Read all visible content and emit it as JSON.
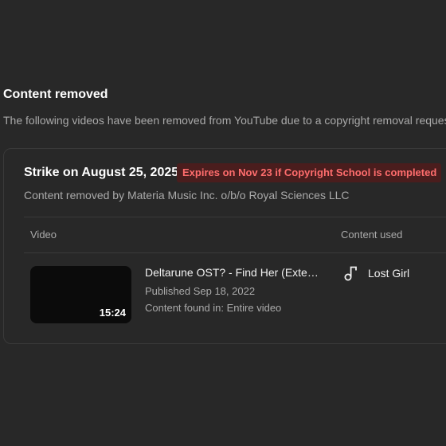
{
  "section": {
    "title": "Content removed",
    "description": "The following videos have been removed from YouTube due to a copyright removal request"
  },
  "strike": {
    "title": "Strike on August 25, 2025",
    "badge": "Expires on Nov 23 if Copyright School is completed",
    "claimant": "Content removed by Materia Music Inc. o/b/o Royal Sciences LLC"
  },
  "table": {
    "headers": {
      "video": "Video",
      "content_used": "Content used"
    },
    "rows": [
      {
        "duration": "15:24",
        "title": "Deltarune OST? - Find Her (Extended)",
        "published": "Published Sep 18, 2022",
        "found": "Content found in: Entire video",
        "content_used_icon": "music-note-icon",
        "content_used": "Lost Girl"
      }
    ]
  },
  "colors": {
    "background": "#282828",
    "badge_bg": "#4a1d1d",
    "badge_text": "#ff6d6d",
    "secondary_text": "#aaaaaa"
  }
}
